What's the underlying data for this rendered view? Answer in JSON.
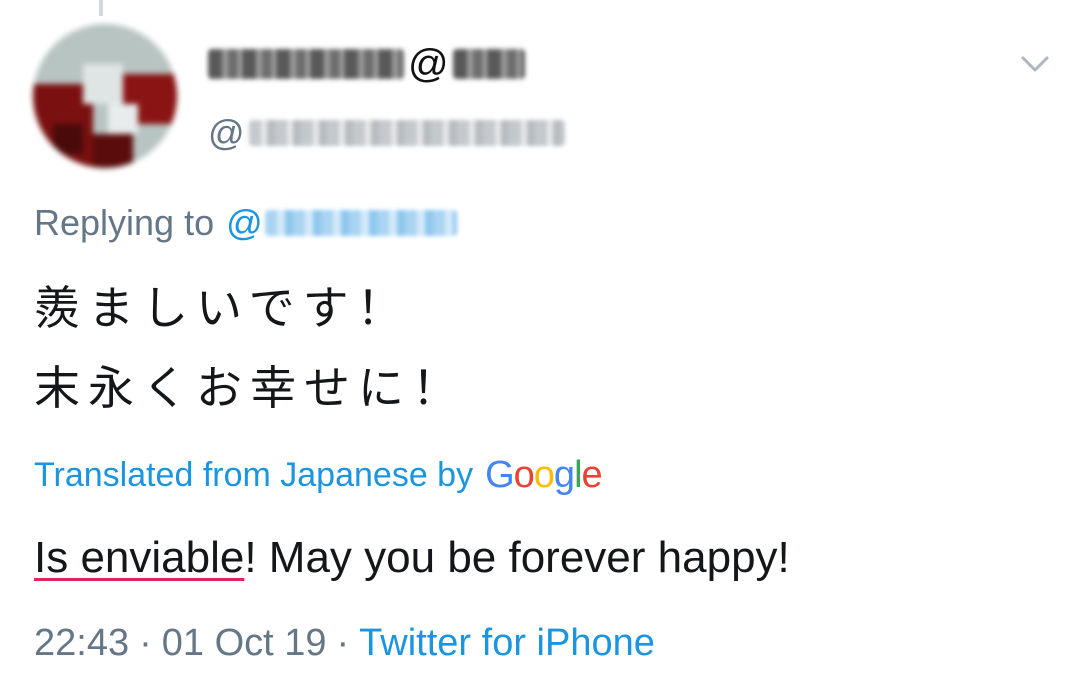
{
  "tweet": {
    "display_name_suffix": "@",
    "handle_prefix": "@",
    "replying_to_label": "Replying to",
    "mention_prefix": "@",
    "text_line1": "羨ましいです！",
    "text_line2": "末永くお幸せに！",
    "translated_label": "Translated from Japanese by",
    "translation_part1": "Is enviable",
    "translation_part2": "! May you be forever happy!",
    "time": "22:43",
    "separator": "·",
    "date": "01 Oct 19",
    "source": "Twitter for iPhone",
    "google_logo": "Google"
  },
  "icons": {
    "more": "chevron-down-icon"
  },
  "colors": {
    "link": "#1b95e0",
    "secondary_text": "#657786",
    "primary_text": "#14171a",
    "spellcheck_underline": "#e0245e"
  }
}
